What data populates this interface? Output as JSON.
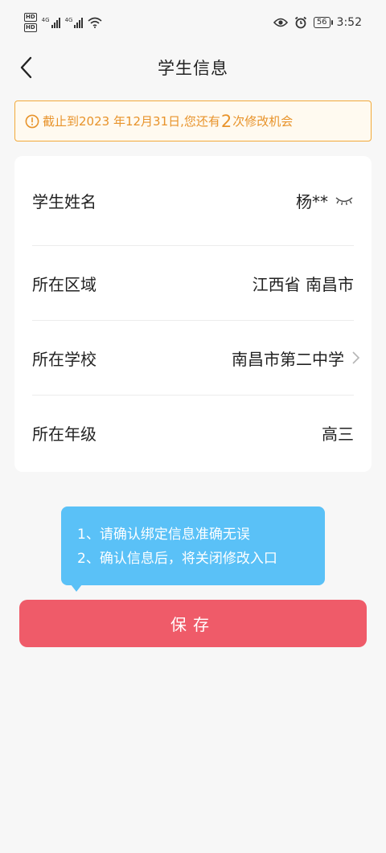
{
  "status_bar": {
    "hd1": "HD",
    "hd2": "HD",
    "net1": "4G",
    "net2": "4G",
    "battery": "56",
    "time": "3:52"
  },
  "nav": {
    "title": "学生信息"
  },
  "notice": {
    "prefix": "截止到2023 年12月31日,您还有",
    "count": "2",
    "suffix": "次修改机会",
    "color": "#e8932a"
  },
  "info": {
    "rows": [
      {
        "label": "学生姓名",
        "value": "杨**",
        "icon": "eye-closed-icon"
      },
      {
        "label": "所在区域",
        "value": "江西省 南昌市"
      },
      {
        "label": "所在学校",
        "value": "南昌市第二中学",
        "icon": "chevron-right-icon"
      },
      {
        "label": "所在年级",
        "value": "高三"
      }
    ]
  },
  "tooltip": {
    "line1": "1、请确认绑定信息准确无误",
    "line2": "2、确认信息后，将关闭修改入口",
    "color": "#5ac1f7"
  },
  "save": {
    "label": "保存",
    "color": "#ef5b69"
  }
}
